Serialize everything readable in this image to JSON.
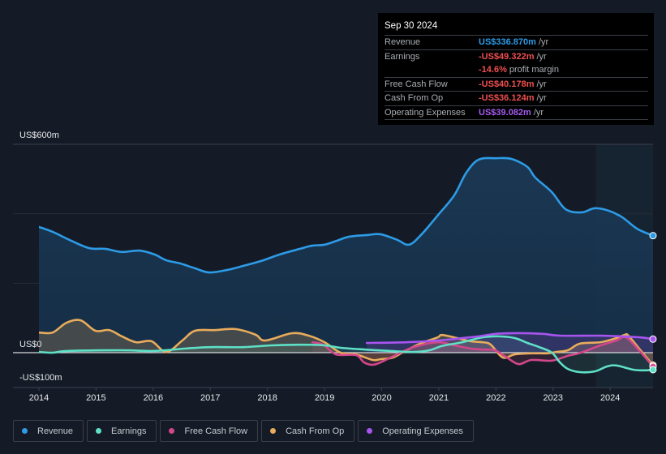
{
  "tooltip": {
    "date": "Sep 30 2024",
    "rows": [
      {
        "label": "Revenue",
        "value": "US$336.870m",
        "unit": "/yr",
        "color": "#2d9be6"
      },
      {
        "label": "Earnings",
        "value": "-US$49.322m",
        "unit": "/yr",
        "color": "#ef4f4f"
      },
      {
        "label": "",
        "value": "-14.6%",
        "unit": "profit margin",
        "color": "#ef4f4f"
      },
      {
        "label": "Free Cash Flow",
        "value": "-US$40.178m",
        "unit": "/yr",
        "color": "#ef4f4f"
      },
      {
        "label": "Cash From Op",
        "value": "-US$36.124m",
        "unit": "/yr",
        "color": "#ef4f4f"
      },
      {
        "label": "Operating Expenses",
        "value": "US$39.082m",
        "unit": "/yr",
        "color": "#a55cf0"
      }
    ]
  },
  "legend": [
    {
      "label": "Revenue",
      "color": "#2d9be6"
    },
    {
      "label": "Earnings",
      "color": "#5ee0c7"
    },
    {
      "label": "Free Cash Flow",
      "color": "#d2478a"
    },
    {
      "label": "Cash From Op",
      "color": "#e8ac5c"
    },
    {
      "label": "Operating Expenses",
      "color": "#a855f0"
    }
  ],
  "chart_data": {
    "type": "line",
    "title": "",
    "xlabel": "",
    "ylabel": "",
    "xlim": [
      2014.0,
      2024.75
    ],
    "ylim": [
      -100,
      600
    ],
    "y_tick_labels": [
      {
        "value": 600,
        "label": "US$600m"
      },
      {
        "value": 0,
        "label": "US$0"
      },
      {
        "value": -100,
        "label": "-US$100m"
      }
    ],
    "gridlines": [
      600,
      400,
      200,
      0
    ],
    "x_ticks": [
      2014,
      2015,
      2016,
      2017,
      2018,
      2019,
      2020,
      2021,
      2022,
      2023,
      2024
    ],
    "x_tick_labels": [
      "2014",
      "2015",
      "2016",
      "2017",
      "2018",
      "2019",
      "2020",
      "2021",
      "2022",
      "2023",
      "2024"
    ],
    "highlight_from": 2023.75,
    "units": "US$m",
    "series": [
      {
        "name": "Revenue",
        "color": "#2d9be6",
        "x": [
          2014.0,
          2014.24,
          2014.53,
          2014.88,
          2015.16,
          2015.45,
          2015.76,
          2016.02,
          2016.23,
          2016.47,
          2016.73,
          2016.98,
          2017.29,
          2017.58,
          2017.89,
          2018.22,
          2018.57,
          2018.78,
          2019.0,
          2019.21,
          2019.43,
          2019.76,
          2019.98,
          2020.27,
          2020.48,
          2020.7,
          2020.99,
          2021.27,
          2021.48,
          2021.7,
          2022.01,
          2022.27,
          2022.55,
          2022.69,
          2022.98,
          2023.22,
          2023.5,
          2023.73,
          2023.97,
          2024.21,
          2024.47,
          2024.75
        ],
        "values": [
          362,
          348,
          325,
          301,
          299,
          290,
          294,
          283,
          266,
          257,
          243,
          231,
          238,
          250,
          264,
          283,
          299,
          308,
          311,
          322,
          334,
          339,
          341,
          325,
          311,
          341,
          397,
          453,
          518,
          556,
          560,
          558,
          535,
          504,
          462,
          413,
          404,
          416,
          409,
          390,
          357,
          337
        ]
      },
      {
        "name": "Earnings",
        "color": "#5ee0c7",
        "x": [
          2014.0,
          2014.24,
          2014.53,
          2015.45,
          2016.02,
          2016.58,
          2017.0,
          2017.58,
          2018.07,
          2018.57,
          2019.0,
          2019.28,
          2019.71,
          2020.13,
          2020.56,
          2020.84,
          2021.05,
          2021.41,
          2021.76,
          2022.05,
          2022.33,
          2022.55,
          2022.76,
          2022.98,
          2023.12,
          2023.26,
          2023.47,
          2023.73,
          2023.94,
          2024.11,
          2024.4,
          2024.61,
          2024.75
        ],
        "values": [
          2,
          0,
          5,
          7,
          5,
          12,
          16,
          16,
          21,
          23,
          21,
          14,
          9,
          5,
          2,
          7,
          19,
          30,
          44,
          47,
          42,
          28,
          16,
          0,
          -28,
          -47,
          -56,
          -54,
          -40,
          -37,
          -49,
          -51,
          -49
        ]
      },
      {
        "name": "Free Cash Flow",
        "color": "#d2478a",
        "x": [
          2018.79,
          2018.98,
          2019.2,
          2019.55,
          2019.69,
          2019.84,
          2019.98,
          2020.27,
          2020.56,
          2020.98,
          2021.27,
          2021.55,
          2021.77,
          2021.98,
          2022.19,
          2022.4,
          2022.62,
          2022.98,
          2023.26,
          2023.47,
          2023.83,
          2024.11,
          2024.28,
          2024.53,
          2024.75
        ],
        "values": [
          30,
          23,
          -5,
          -7,
          -28,
          -35,
          -28,
          -5,
          16,
          30,
          21,
          12,
          9,
          7,
          -14,
          -33,
          -21,
          -23,
          -9,
          -1,
          21,
          35,
          44,
          2,
          -40
        ]
      },
      {
        "name": "Cash From Op",
        "color": "#e8ac5c",
        "x": [
          2014.0,
          2014.24,
          2014.48,
          2014.73,
          2014.99,
          2015.23,
          2015.45,
          2015.7,
          2015.97,
          2016.23,
          2016.51,
          2016.73,
          2017.08,
          2017.44,
          2017.79,
          2017.96,
          2018.43,
          2018.72,
          2019.0,
          2019.28,
          2019.55,
          2019.84,
          2019.98,
          2020.2,
          2020.41,
          2020.7,
          2020.98,
          2021.05,
          2021.27,
          2021.55,
          2021.77,
          2021.91,
          2022.12,
          2022.33,
          2022.62,
          2022.91,
          2023.05,
          2023.26,
          2023.47,
          2023.83,
          2024.11,
          2024.25,
          2024.32,
          2024.53,
          2024.75
        ],
        "values": [
          58,
          58,
          86,
          93,
          63,
          65,
          47,
          30,
          33,
          2,
          35,
          63,
          65,
          68,
          52,
          35,
          56,
          49,
          30,
          0,
          -5,
          -21,
          -19,
          -14,
          5,
          28,
          44,
          51,
          44,
          33,
          30,
          23,
          -14,
          -5,
          -2,
          -2,
          2,
          7,
          26,
          30,
          42,
          51,
          49,
          7,
          -36
        ]
      },
      {
        "name": "Operating Expenses",
        "color": "#a855f0",
        "x": [
          2019.74,
          2020.42,
          2020.99,
          2021.41,
          2021.7,
          2021.98,
          2022.27,
          2022.55,
          2022.84,
          2023.12,
          2023.83,
          2024.19,
          2024.54,
          2024.75
        ],
        "values": [
          28,
          30,
          35,
          42,
          47,
          54,
          56,
          56,
          54,
          49,
          49,
          47,
          44,
          39
        ]
      }
    ]
  }
}
